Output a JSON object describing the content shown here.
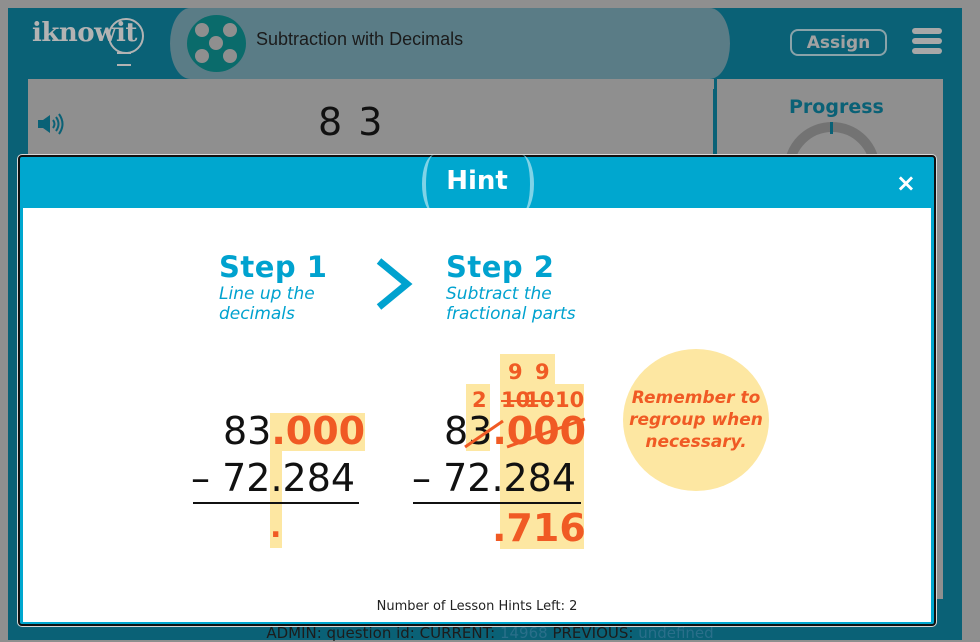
{
  "header": {
    "logo": "iknowit",
    "lesson_title": "Subtraction with Decimals",
    "assign_label": "Assign",
    "menu_icon": "hamburger-menu-icon"
  },
  "question": {
    "speaker_icon": "speaker-icon",
    "text": "8 3"
  },
  "progress": {
    "label": "Progress"
  },
  "hint": {
    "title": "Hint",
    "close_label": "×",
    "step1": {
      "title": "Step 1",
      "line1": "Line up the",
      "line2": "decimals"
    },
    "step2": {
      "title": "Step 2",
      "line1": "Subtract the",
      "line2": "fractional parts"
    },
    "example1": {
      "top_whole": "83",
      "top_fraction": ".000",
      "minus": "–",
      "bottom": "72.284",
      "result": "."
    },
    "example2": {
      "regroup_ones": "2",
      "regroup_nines": [
        "9",
        "9"
      ],
      "regroup_tens": [
        "10",
        "10",
        "10"
      ],
      "top_whole": "83",
      "top_fraction": ".000",
      "minus": "–",
      "bottom": "72.284",
      "result": ".716"
    },
    "remember": "Remember to regroup when necessary.",
    "hints_left": "Number of Lesson Hints Left: 2"
  },
  "admin": {
    "prefix": "ADMIN: question id: CURRENT: ",
    "current_id": "14968",
    "previous_label": " PREVIOUS: ",
    "previous_id": "undefined"
  },
  "colors": {
    "brand_dark": "#0a6176",
    "hint_blue": "#00a7cf",
    "highlight": "#fde7a2",
    "accent_orange": "#f05a24"
  }
}
